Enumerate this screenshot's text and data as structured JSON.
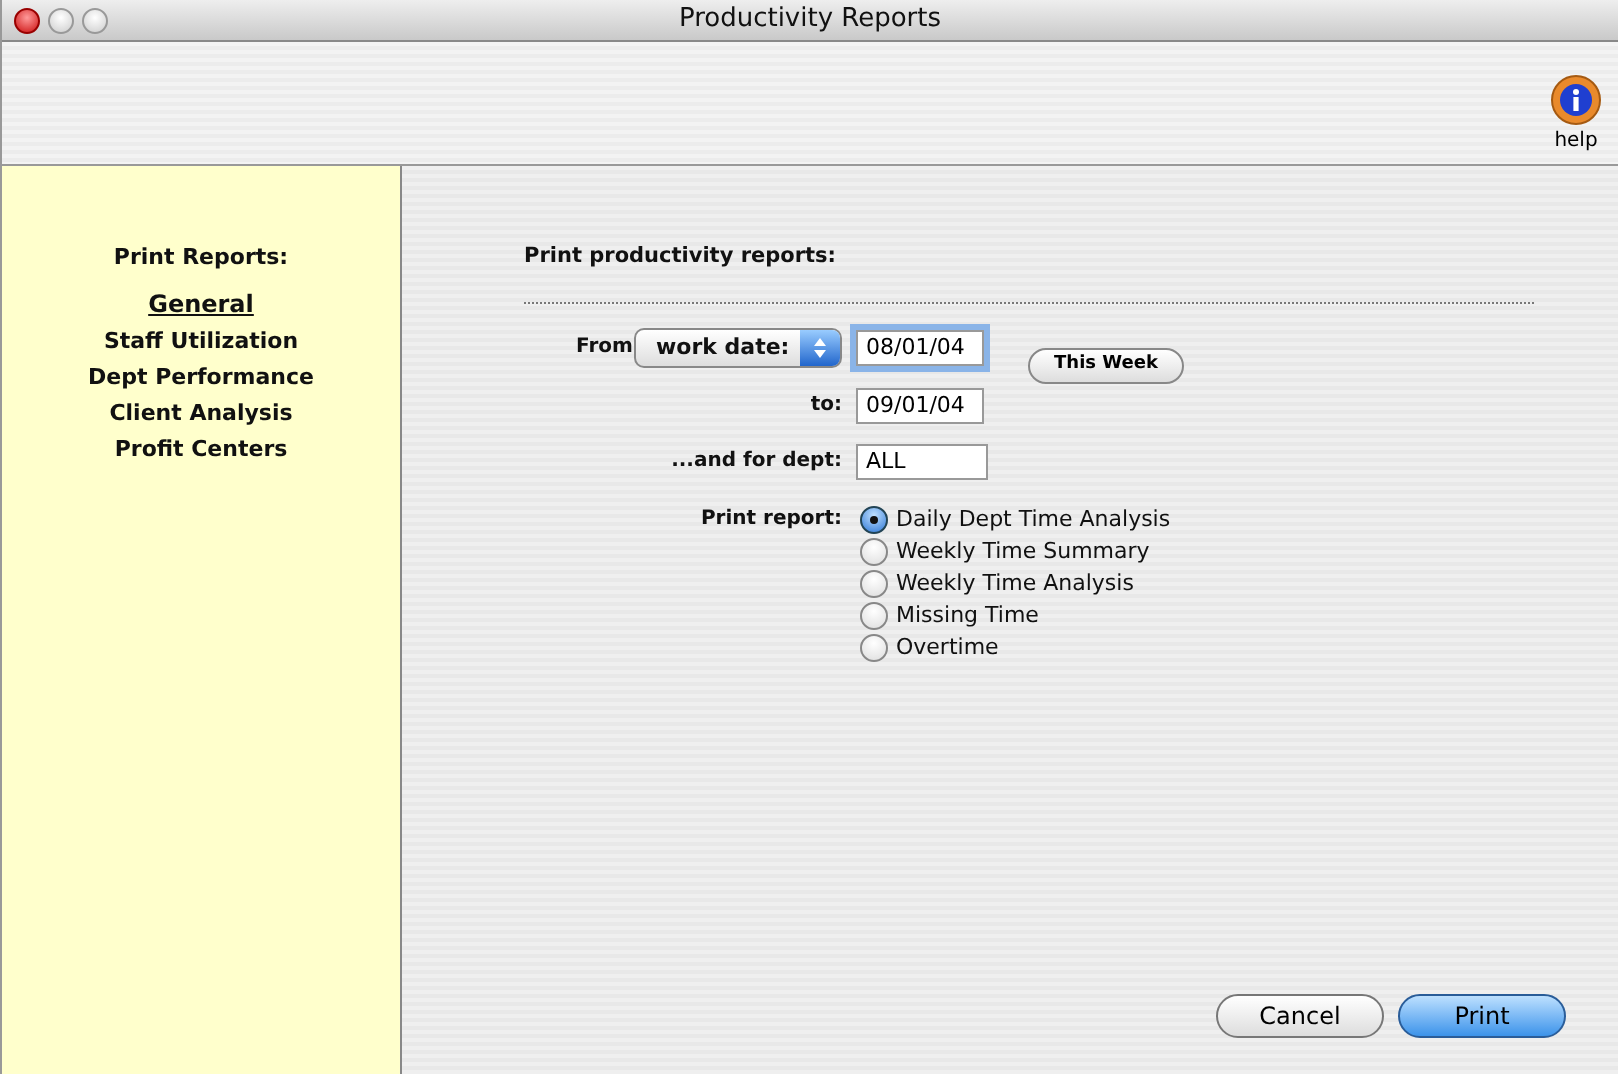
{
  "window": {
    "title": "Productivity Reports"
  },
  "toolbar": {
    "help_label": "help"
  },
  "sidebar": {
    "heading": "Print Reports:",
    "items": [
      {
        "label": "General",
        "selected": true
      },
      {
        "label": "Staff Utilization",
        "selected": false
      },
      {
        "label": "Dept Performance",
        "selected": false
      },
      {
        "label": "Client Analysis",
        "selected": false
      },
      {
        "label": "Profit Centers",
        "selected": false
      }
    ]
  },
  "form": {
    "heading": "Print productivity reports:",
    "from_label": "From",
    "date_type": "work date:",
    "from_date": "08/01/04",
    "this_week_button": "This Week",
    "to_label": "to:",
    "to_date": "09/01/04",
    "dept_label": "...and for dept:",
    "dept": "ALL",
    "report_label": "Print report:",
    "reports": [
      {
        "label": "Daily Dept Time Analysis",
        "selected": true
      },
      {
        "label": "Weekly Time Summary",
        "selected": false
      },
      {
        "label": "Weekly Time Analysis",
        "selected": false
      },
      {
        "label": "Missing Time",
        "selected": false
      },
      {
        "label": "Overtime",
        "selected": false
      }
    ]
  },
  "buttons": {
    "cancel": "Cancel",
    "print": "Print"
  }
}
